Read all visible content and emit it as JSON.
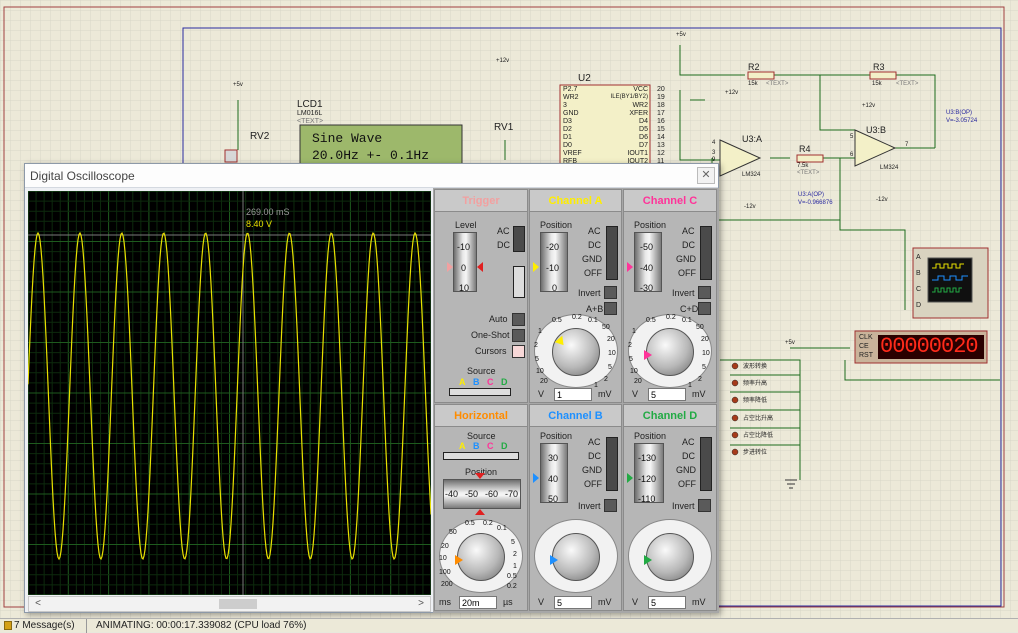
{
  "schematic": {
    "lcd": {
      "ref": "LCD1",
      "part": "LM016L",
      "text_tag": "<TEXT>",
      "line1": "Sine Wave",
      "line2": "20.0Hz  +- 0.1Hz"
    },
    "rv2": "RV2",
    "rv1": "RV1",
    "u2": {
      "ref": "U2",
      "pins_left": [
        "P2.7",
        "WR2",
        "3",
        "GND",
        "D3",
        "D2",
        "D1",
        "D0",
        "VREF",
        "RFB"
      ],
      "pins_right": [
        "VCC",
        "ILE(BY1/BY2)",
        "WR2",
        "XFER",
        "D4",
        "D5",
        "D6",
        "D7",
        "IOUT1",
        "IOUT2"
      ],
      "pin_nums": [
        "20",
        "19",
        "18",
        "17",
        "16",
        "15",
        "14",
        "13",
        "12",
        "11"
      ]
    },
    "r2": {
      "ref": "R2",
      "value": "15k",
      "text": "<TEXT>"
    },
    "r3": {
      "ref": "R3",
      "value": "15k",
      "text": "<TEXT>"
    },
    "r4": {
      "ref": "R4",
      "value": "7.5k",
      "text": "<TEXT>"
    },
    "u3a": {
      "ref": "U3:A",
      "part": "LM324",
      "probe_name": "U3:A(OP)",
      "probe_value": "V=-0.966876"
    },
    "u3b": {
      "ref": "U3:B",
      "part": "LM324",
      "probe_name": "U3:B(OP)",
      "probe_value": "V=-3.05724"
    },
    "supplies": [
      "+5v",
      "+5v",
      "+12v",
      "+12v",
      "-12v",
      "+12v",
      "-12v",
      "+5v"
    ],
    "pin_labels": {
      "u3a_minus": "4",
      "u3a_plus": "3",
      "u3a_pin11": "11",
      "u3a_pin9": "9",
      "u3b_pin5": "5",
      "u3b_pin6": "6",
      "u3b_pin7": "7"
    },
    "scope_channels": [
      "A",
      "B",
      "C",
      "D"
    ],
    "counter": {
      "pins": [
        "CLK",
        "CE",
        "RST"
      ],
      "display": "00000020"
    },
    "buttons": [
      "波形转换",
      "频率升高",
      "频率降低",
      "占空比升高",
      "占空比降低",
      "步进转位"
    ]
  },
  "oscilloscope": {
    "title": "Digital Oscilloscope",
    "close": "✕",
    "cursor_time": "269.00 mS",
    "cursor_volt": "8.40 V",
    "trigger": {
      "title": "Trigger",
      "level_label": "Level",
      "ticks": [
        "-10",
        "0",
        "10"
      ],
      "ac": "AC",
      "dc": "DC",
      "auto": "Auto",
      "one_shot": "One-Shot",
      "cursors": "Cursors",
      "source_label": "Source",
      "sources": [
        "A",
        "B",
        "C",
        "D"
      ]
    },
    "channel_a": {
      "title": "Channel A",
      "position_label": "Position",
      "ticks": [
        "-20",
        "-10",
        "0"
      ],
      "ac": "AC",
      "dc": "DC",
      "gnd": "GND",
      "off": "OFF",
      "invert": "Invert",
      "combo": "A+B",
      "dial_labels": [
        "0.5",
        "0.2",
        "0.1",
        "50",
        "1",
        "20",
        "2",
        "10",
        "5",
        "5",
        "10",
        "2",
        "20",
        "1"
      ],
      "unit_left": "V",
      "value": "1",
      "unit_right": "mV"
    },
    "channel_c": {
      "title": "Channel C",
      "position_label": "Position",
      "ticks": [
        "-50",
        "-40",
        "-30"
      ],
      "ac": "AC",
      "dc": "DC",
      "gnd": "GND",
      "off": "OFF",
      "invert": "Invert",
      "combo": "C+D",
      "dial_labels": [
        "0.5",
        "0.2",
        "0.1",
        "50",
        "1",
        "20",
        "2",
        "10",
        "5",
        "5",
        "10",
        "2",
        "20",
        "1"
      ],
      "unit_left": "V",
      "value": "5",
      "unit_right": "mV"
    },
    "horizontal": {
      "title": "Horizontal",
      "source_label": "Source",
      "sources": [
        "A",
        "B",
        "C",
        "D"
      ],
      "position_label": "Position",
      "ticks": [
        "-40",
        "-50",
        "-60",
        "-70"
      ],
      "dial_labels": [
        "0.5",
        "0.2",
        "0.1",
        "50",
        "20",
        "10",
        "5",
        "2",
        "1",
        "0.5",
        "0.2",
        "100",
        "200"
      ],
      "unit_left": "ms",
      "value": "20m",
      "unit_right": "µs"
    },
    "channel_b": {
      "title": "Channel B",
      "position_label": "Position",
      "ticks": [
        "30",
        "40",
        "50"
      ],
      "ac": "AC",
      "dc": "DC",
      "gnd": "GND",
      "off": "OFF",
      "invert": "Invert",
      "unit_left": "V",
      "value": "5",
      "unit_right": "mV"
    },
    "channel_d": {
      "title": "Channel D",
      "position_label": "Position",
      "ticks": [
        "-130",
        "-120",
        "-110"
      ],
      "ac": "AC",
      "dc": "DC",
      "gnd": "GND",
      "off": "OFF",
      "invert": "Invert",
      "unit_left": "V",
      "value": "5",
      "unit_right": "mV"
    },
    "colors": {
      "trigger": "#f2a0a0",
      "a": "#ffee00",
      "b": "#1e90ff",
      "c": "#ff3399",
      "d": "#22aa44",
      "horizontal": "#ff8c00",
      "trace": "#e8e000"
    }
  },
  "status": {
    "messages": "7 Message(s)",
    "animating": "ANIMATING: 00:00:17.339082 (CPU load 76%)"
  }
}
